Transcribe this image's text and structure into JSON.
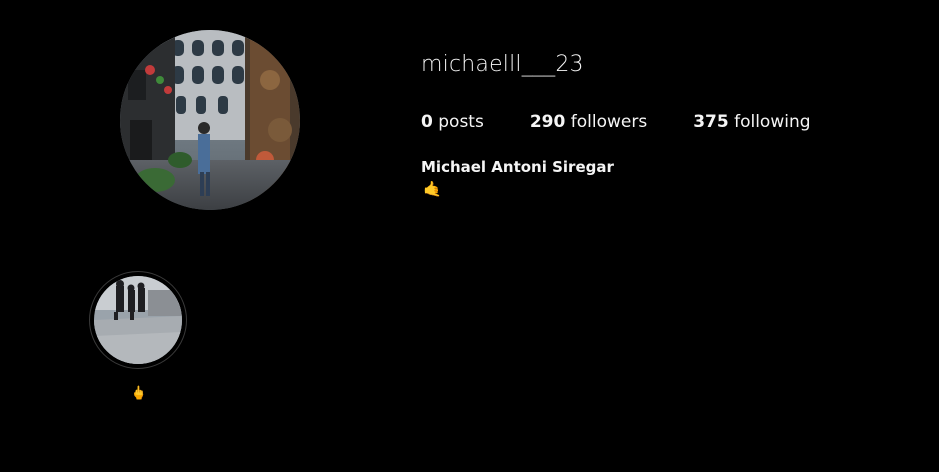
{
  "profile": {
    "username": "michaelll___23",
    "full_name": "Michael Antoni Siregar",
    "bio": "🤙",
    "avatar_icon": "profile-photo-street-scene"
  },
  "stats": {
    "posts_count": "0",
    "posts_label": "posts",
    "followers_count": "290",
    "followers_label": "followers",
    "following_count": "375",
    "following_label": "following"
  },
  "highlights": [
    {
      "label": "🖕",
      "cover_icon": "highlight-cover-street-scene"
    }
  ],
  "colors": {
    "background": "#000000",
    "text": "#f5f5f5",
    "highlight_ring": "#3a3a3a"
  }
}
